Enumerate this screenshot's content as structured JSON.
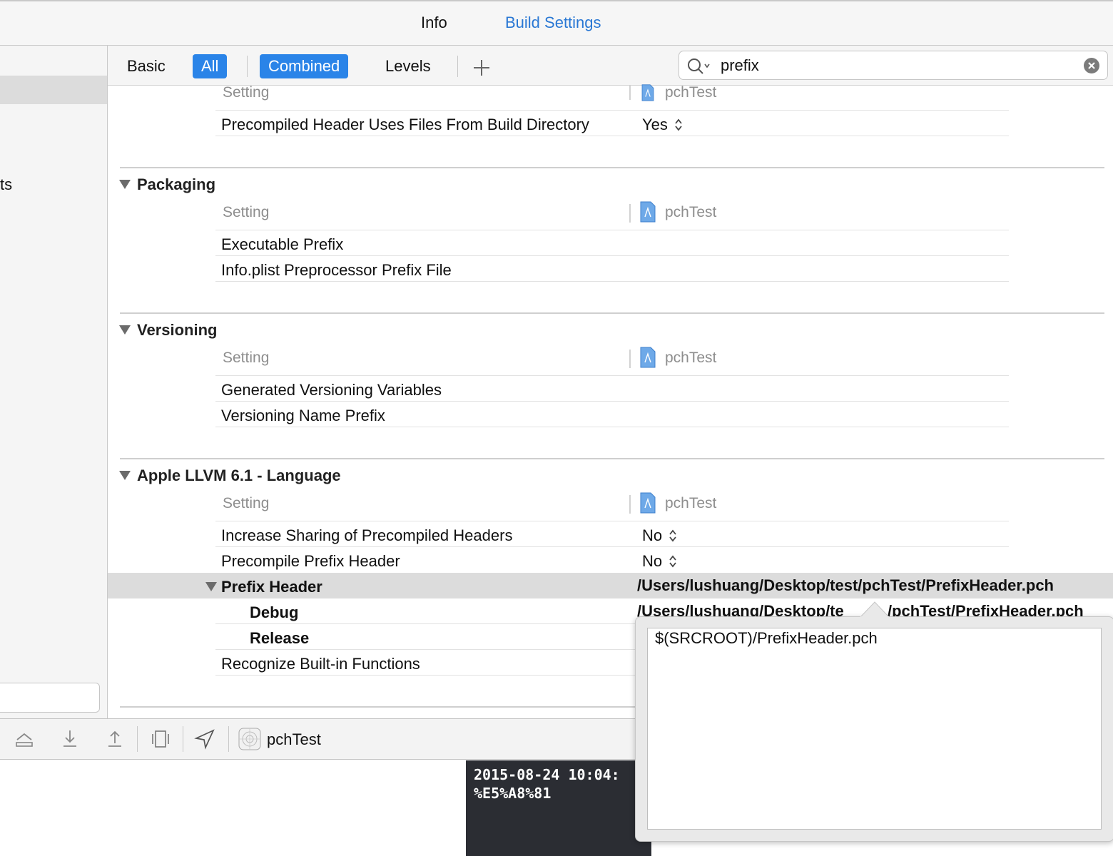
{
  "tabs": {
    "info": "Info",
    "build_settings": "Build Settings"
  },
  "sidebar": {
    "partial_label": "ts"
  },
  "filter": {
    "basic": "Basic",
    "all": "All",
    "combined": "Combined",
    "levels": "Levels",
    "search_value": "prefix"
  },
  "header": {
    "setting": "Setting",
    "target": "pchTest"
  },
  "sections": {
    "top": {
      "row1_label": "Precompiled Header Uses Files From Build Directory",
      "row1_value": "Yes"
    },
    "packaging": {
      "title": "Packaging",
      "rows": [
        "Executable Prefix",
        "Info.plist Preprocessor Prefix File"
      ]
    },
    "versioning": {
      "title": "Versioning",
      "rows": [
        "Generated Versioning Variables",
        "Versioning Name Prefix"
      ]
    },
    "llvm": {
      "title": "Apple LLVM 6.1 - Language",
      "row_sharing": "Increase Sharing of Precompiled Headers",
      "row_sharing_value": "No",
      "row_precompile": "Precompile Prefix Header",
      "row_precompile_value": "No",
      "row_prefix": "Prefix Header",
      "row_prefix_value": "/Users/lushuang/Desktop/test/pchTest/PrefixHeader.pch",
      "row_debug": "Debug",
      "row_debug_value_a": "/Users/lushuang/Desktop/te",
      "row_debug_value_b": "/pchTest/PrefixHeader.pch",
      "row_release": "Release",
      "row_builtin": "Recognize Built-in Functions"
    }
  },
  "bottombar": {
    "scheme": "pchTest"
  },
  "console": {
    "line1": "2015-08-24 10:04:",
    "line2": "%E5%A8%81"
  },
  "popover": {
    "value": "$(SRCROOT)/PrefixHeader.pch"
  },
  "colors": {
    "accent": "#2a84e8",
    "link": "#2a78d4"
  }
}
